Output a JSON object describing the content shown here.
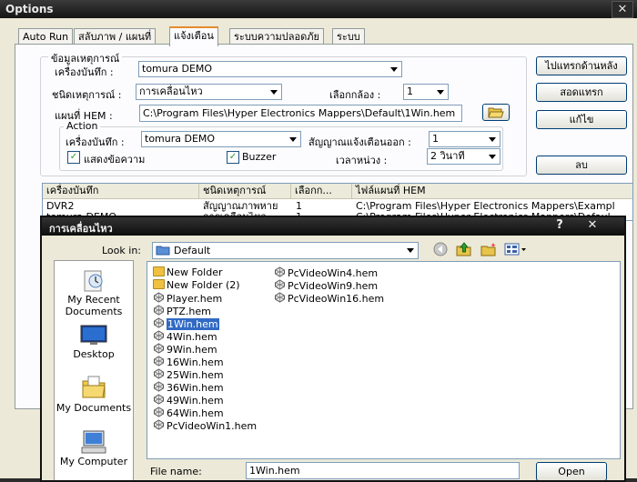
{
  "window": {
    "title": "Options"
  },
  "tabs": [
    "Auto Run",
    "สลับภาพ / แผนที่",
    "แจ้งเตือน",
    "ระบบความปลอดภัย",
    "ระบบ"
  ],
  "info_group": {
    "title": "ข้อมูลเหตุการณ์",
    "recorder_label": "เครื่องบันทึก :",
    "recorder_value": "tomura DEMO",
    "event_type_label": "ชนิดเหตุการณ์ :",
    "event_type_value": "การเคลื่อนไหว",
    "camera_label": "เลือกกล้อง :",
    "camera_value": "1",
    "hem_label": "แผนที่ HEM :",
    "hem_value": "C:\\Program Files\\Hyper Electronics Mappers\\Default\\1Win.hem"
  },
  "action_group": {
    "title": "Action",
    "recorder_label": "เครื่องบันทึก :",
    "recorder_value": "tomura DEMO",
    "signal_label": "สัญญาณแจ้งเตือนออก :",
    "signal_value": "1",
    "show_msg_label": "แสดงข้อความ",
    "buzzer_label": "Buzzer",
    "delay_label": "เวลาหน่วง :",
    "delay_value": "2 วินาที"
  },
  "side_buttons": {
    "insert_back": "ไปแทรกด้านหลัง",
    "insert": "สอดแทรก",
    "edit": "แก้ไข",
    "delete": "ลบ"
  },
  "list": {
    "headers": [
      "เครื่องบันทึก",
      "ชนิดเหตุการณ์",
      "เลือกก...",
      "ไฟล์แผนที่ HEM"
    ],
    "rows": [
      [
        "DVR2",
        "สัญญาณภาพหาย",
        "1",
        "C:\\Program Files\\Hyper Electronics Mappers\\Exampl"
      ],
      [
        "tomura DEMO",
        "การเคลื่อนไหว",
        "1",
        "C:\\Program Files\\Hyper Electronics Mappers\\Defaul"
      ]
    ]
  },
  "dialog": {
    "title": "การเคลื่อนไหว",
    "help": "?",
    "close": "✕",
    "look_in_label": "Look in:",
    "look_in_value": "Default",
    "places": [
      "My Recent Documents",
      "Desktop",
      "My Documents",
      "My Computer"
    ],
    "files_col1": [
      "New Folder",
      "New Folder (2)",
      "Player.hem",
      "PTZ.hem",
      "1Win.hem",
      "4Win.hem",
      "9Win.hem",
      "16Win.hem",
      "25Win.hem",
      "36Win.hem",
      "49Win.hem",
      "64Win.hem",
      "PcVideoWin1.hem"
    ],
    "files_col2": [
      "PcVideoWin4.hem",
      "PcVideoWin9.hem",
      "PcVideoWin16.hem"
    ],
    "selected_file": "1Win.hem",
    "file_name_label": "File name:",
    "file_name_value": "1Win.hem",
    "open_button": "Open"
  }
}
